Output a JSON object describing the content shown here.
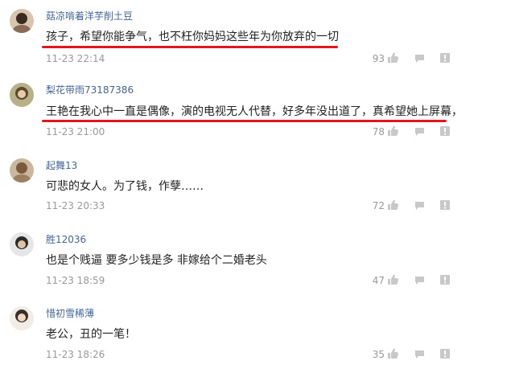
{
  "comments": [
    {
      "username": "菇凉啃着洋芋削土豆",
      "text": "孩子，希望你能争气，也不枉你妈妈这些年为你放弃的一切",
      "time": "11-23 22:14",
      "likes": "93"
    },
    {
      "username": "梨花带雨73187386",
      "text": "王艳在我心中一直是偶像，演的电视无人代替，好多年没出道了，真希望她上屏幕，",
      "time": "11-23 21:00",
      "likes": "78"
    },
    {
      "username": "起舞13",
      "text": "可悲的女人。为了钱，作孽……",
      "time": "11-23 20:33",
      "likes": "72"
    },
    {
      "username": "胜12036",
      "text": "也是个贱逼 要多少钱是多 非嫁给个二婚老头",
      "time": "11-23 18:59",
      "likes": "47"
    },
    {
      "username": "惜初雪稀薄",
      "text": "老公，丑的一笔！",
      "time": "11-23 18:26",
      "likes": "35"
    }
  ],
  "colors": {
    "username": "#406599",
    "highlight": "#e5161b",
    "meta": "#999999"
  },
  "icons": {
    "like": "thumbs-up-icon",
    "reply": "comment-icon",
    "report": "report-icon"
  }
}
